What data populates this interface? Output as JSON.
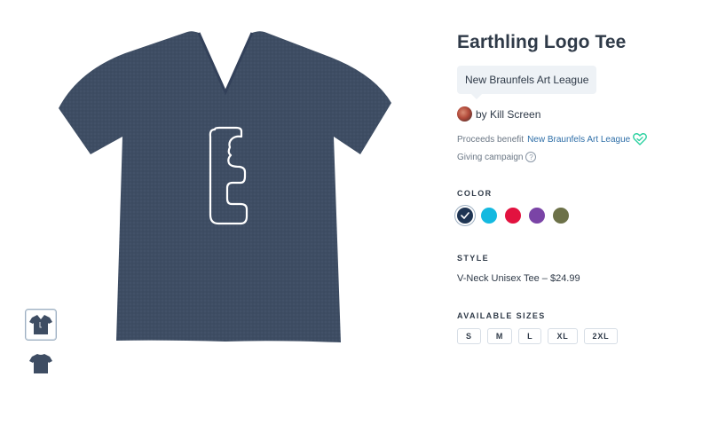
{
  "product": {
    "title": "Earthling Logo Tee",
    "campaign_name": "New Braunfels Art League",
    "byline": "by Kill Screen",
    "proceeds_text": "Proceeds benefit",
    "proceeds_link": "New Braunfels Art League",
    "giving_text": "Giving campaign",
    "info_icon_glyph": "?"
  },
  "color": {
    "label": "COLOR",
    "swatches": [
      {
        "name": "navy",
        "hex": "#1f3553",
        "selected": true
      },
      {
        "name": "cyan",
        "hex": "#14b9e0",
        "selected": false
      },
      {
        "name": "red",
        "hex": "#e2123f",
        "selected": false
      },
      {
        "name": "purple",
        "hex": "#7a44a6",
        "selected": false
      },
      {
        "name": "olive",
        "hex": "#6c7148",
        "selected": false
      }
    ]
  },
  "style": {
    "label": "STYLE",
    "value": "V-Neck Unisex Tee – $24.99"
  },
  "sizes": {
    "label": "AVAILABLE SIZES",
    "options": [
      "S",
      "M",
      "L",
      "XL",
      "2XL"
    ]
  },
  "icons": {
    "heart": "heart-outline-icon",
    "info": "info-circle-icon"
  },
  "theme": {
    "shirt": "#3e4d63",
    "accent_heart": "#2bd1a0",
    "link": "#2f6fa8"
  }
}
